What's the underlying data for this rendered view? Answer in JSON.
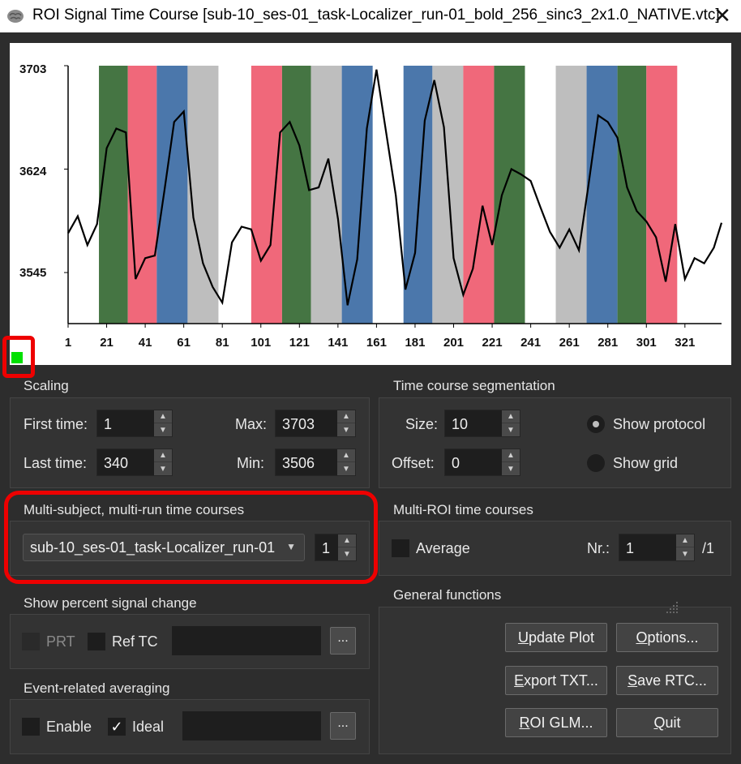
{
  "window": {
    "title": "ROI Signal Time Course  [sub-10_ses-01_task-Localizer_run-01_bold_256_sinc3_2x1.0_NATIVE.vtc]",
    "close_glyph": "✕",
    "icon": "brain-app-icon"
  },
  "chart_data": {
    "type": "line",
    "title": "",
    "xlabel": "",
    "ylabel": "",
    "y_tick_labels": [
      "3703",
      "3624",
      "3545"
    ],
    "x_tick_labels": [
      "1",
      "21",
      "41",
      "61",
      "81",
      "101",
      "121",
      "141",
      "161",
      "181",
      "201",
      "221",
      "241",
      "261",
      "281",
      "301",
      "321"
    ],
    "xlim": [
      1,
      340
    ],
    "ylim": [
      3506,
      3703
    ],
    "protocol_colors": {
      "green": "#457543",
      "red": "#f0687a",
      "blue": "#4b77ab",
      "gray": "#bebebe"
    },
    "protocol_blocks": [
      {
        "start": 17,
        "end": 32,
        "color": "green"
      },
      {
        "start": 32,
        "end": 47,
        "color": "red"
      },
      {
        "start": 47,
        "end": 63,
        "color": "blue"
      },
      {
        "start": 63,
        "end": 79,
        "color": "gray"
      },
      {
        "start": 96,
        "end": 112,
        "color": "red"
      },
      {
        "start": 112,
        "end": 127,
        "color": "green"
      },
      {
        "start": 127,
        "end": 143,
        "color": "gray"
      },
      {
        "start": 143,
        "end": 159,
        "color": "blue"
      },
      {
        "start": 175,
        "end": 190,
        "color": "blue"
      },
      {
        "start": 190,
        "end": 206,
        "color": "gray"
      },
      {
        "start": 206,
        "end": 222,
        "color": "red"
      },
      {
        "start": 222,
        "end": 238,
        "color": "green"
      },
      {
        "start": 254,
        "end": 270,
        "color": "gray"
      },
      {
        "start": 270,
        "end": 286,
        "color": "blue"
      },
      {
        "start": 286,
        "end": 301,
        "color": "green"
      },
      {
        "start": 301,
        "end": 317,
        "color": "red"
      }
    ],
    "series": [
      {
        "x": [
          1,
          6,
          11,
          16,
          21,
          26,
          31,
          36,
          41,
          46,
          51,
          56,
          61,
          66,
          71,
          76,
          81,
          86,
          91,
          96,
          101,
          106,
          111,
          116,
          121,
          126,
          131,
          136,
          141,
          146,
          151,
          156,
          161,
          166,
          171,
          176,
          181,
          186,
          191,
          196,
          201,
          206,
          211,
          216,
          221,
          226,
          231,
          236,
          241,
          246,
          251,
          256,
          261,
          266,
          271,
          276,
          281,
          286,
          291,
          296,
          301,
          306,
          311,
          316,
          321,
          326,
          331,
          336,
          340
        ],
        "y": [
          3575,
          3588,
          3566,
          3582,
          3640,
          3655,
          3652,
          3540,
          3556,
          3558,
          3608,
          3660,
          3668,
          3587,
          3552,
          3534,
          3522,
          3568,
          3580,
          3578,
          3554,
          3566,
          3652,
          3660,
          3642,
          3608,
          3610,
          3632,
          3586,
          3520,
          3555,
          3655,
          3700,
          3652,
          3604,
          3532,
          3560,
          3661,
          3692,
          3656,
          3556,
          3528,
          3548,
          3596,
          3566,
          3604,
          3624,
          3620,
          3615,
          3595,
          3576,
          3564,
          3578,
          3562,
          3612,
          3665,
          3660,
          3648,
          3610,
          3592,
          3584,
          3572,
          3538,
          3582,
          3540,
          3556,
          3552,
          3564,
          3583
        ]
      }
    ],
    "grid": false,
    "legend": "none"
  },
  "scaling": {
    "title": "Scaling",
    "first_time_label": "First time:",
    "first_time": "1",
    "last_time_label": "Last time:",
    "last_time": "340",
    "max_label": "Max:",
    "max": "3703",
    "min_label": "Min:",
    "min": "3506"
  },
  "segmentation": {
    "title": "Time course segmentation",
    "size_label": "Size:",
    "size": "10",
    "offset_label": "Offset:",
    "offset": "0",
    "show_protocol": "Show protocol",
    "show_grid": "Show grid"
  },
  "multi_subject": {
    "title": "Multi-subject, multi-run time courses",
    "selected": "sub-10_ses-01_task-Localizer_run-01",
    "index": "1"
  },
  "multi_roi": {
    "title": "Multi-ROI time courses",
    "average_label": "Average",
    "nr_label": "Nr.:",
    "nr": "1",
    "total": "/1"
  },
  "percent_signal": {
    "title": "Show percent signal change",
    "prt_label": "PRT",
    "ref_tc_label": "Ref TC",
    "browse": "..."
  },
  "event_related": {
    "title": "Event-related averaging",
    "enable_label": "Enable",
    "ideal_label": "Ideal",
    "check_glyph": "✓",
    "browse": "..."
  },
  "general": {
    "title": "General functions",
    "update_plot": {
      "u": "U",
      "rest": "pdate Plot"
    },
    "options": {
      "u": "O",
      "rest": "ptions..."
    },
    "export_txt": {
      "u": "E",
      "rest": "xport TXT..."
    },
    "save_rtc": {
      "u": "S",
      "rest": "ave RTC..."
    },
    "roi_glm": {
      "u": "R",
      "rest": "OI GLM..."
    },
    "quit": {
      "u": "Q",
      "rest": "uit"
    }
  }
}
